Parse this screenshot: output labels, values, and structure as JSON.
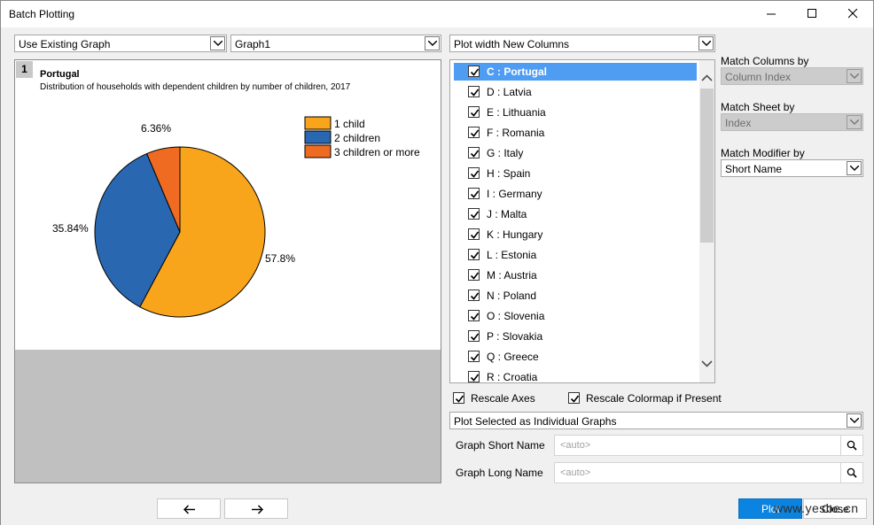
{
  "window": {
    "title": "Batch Plotting"
  },
  "top_combos": {
    "graph_mode": "Use Existing Graph",
    "graph_name": "Graph1",
    "plot_with": "Plot width New Columns"
  },
  "graph": {
    "page_number": "1",
    "title": "Portugal",
    "subtitle": "Distribution of households with dependent children by number of children, 2017"
  },
  "chart_data": {
    "type": "pie",
    "title": "Portugal",
    "subtitle": "Distribution of households with dependent children by number of children, 2017",
    "slices": [
      {
        "name": "1 child",
        "value": 57.8,
        "label": "57.8%",
        "color": "#f9a51c"
      },
      {
        "name": "2 children",
        "value": 35.84,
        "label": "35.84%",
        "color": "#2a67b1"
      },
      {
        "name": "3 children or more",
        "value": 6.36,
        "label": "6.36%",
        "color": "#f06b22"
      }
    ],
    "legend_position": "top-right"
  },
  "columns": [
    {
      "label": "C : Portugal",
      "checked": true,
      "selected": true
    },
    {
      "label": "D : Latvia",
      "checked": true
    },
    {
      "label": "E : Lithuania",
      "checked": true
    },
    {
      "label": "F : Romania",
      "checked": true
    },
    {
      "label": "G : Italy",
      "checked": true
    },
    {
      "label": "H : Spain",
      "checked": true
    },
    {
      "label": "I : Germany",
      "checked": true
    },
    {
      "label": "J : Malta",
      "checked": true
    },
    {
      "label": "K : Hungary",
      "checked": true
    },
    {
      "label": "L : Estonia",
      "checked": true
    },
    {
      "label": "M : Austria",
      "checked": true
    },
    {
      "label": "N : Poland",
      "checked": true
    },
    {
      "label": "O : Slovenia",
      "checked": true
    },
    {
      "label": "P : Slovakia",
      "checked": true
    },
    {
      "label": "Q : Greece",
      "checked": true
    },
    {
      "label": "R : Croatia",
      "checked": true
    }
  ],
  "match": {
    "columns_label": "Match Columns by",
    "columns_value": "Column Index",
    "sheet_label": "Match Sheet by",
    "sheet_value": "Index",
    "modifier_label": "Match Modifier by",
    "modifier_value": "Short Name"
  },
  "options": {
    "rescale_axes": "Rescale Axes",
    "rescale_colormap": "Rescale Colormap if Present",
    "plot_selected": "Plot Selected as Individual Graphs"
  },
  "names": {
    "short_label": "Graph Short Name",
    "short_placeholder": "<auto>",
    "long_label": "Graph Long Name",
    "long_placeholder": "<auto>"
  },
  "buttons": {
    "plot": "Plot",
    "close": "Close"
  },
  "watermark": "www.yesbe.cn"
}
